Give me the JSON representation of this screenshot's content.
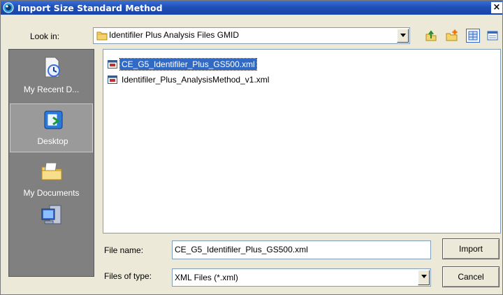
{
  "window": {
    "title": "Import Size Standard Method",
    "close_glyph": "×"
  },
  "look_in": {
    "label": "Look in:",
    "value": "Identifiler Plus Analysis Files GMID"
  },
  "toolbar": {
    "icons": [
      "up-folder-icon",
      "new-folder-icon",
      "list-view-icon",
      "details-view-icon"
    ]
  },
  "places": [
    {
      "label": "My Recent D...",
      "icon": "recent-documents-icon"
    },
    {
      "label": "Desktop",
      "icon": "desktop-icon"
    },
    {
      "label": "My Documents",
      "icon": "my-documents-icon"
    },
    {
      "label": "",
      "icon": "my-computer-icon"
    }
  ],
  "files": [
    {
      "name": "CE_G5_Identifiler_Plus_GS500.xml",
      "selected": true
    },
    {
      "name": "Identifiler_Plus_AnalysisMethod_v1.xml",
      "selected": false
    }
  ],
  "file_name": {
    "label": "File name:",
    "value": "CE_G5_Identifiler_Plus_GS500.xml"
  },
  "file_type": {
    "label": "Files of type:",
    "value": "XML Files (*.xml)"
  },
  "buttons": {
    "import": "Import",
    "cancel": "Cancel"
  },
  "colors": {
    "titlebar": "#1f4fb8",
    "selection": "#316ac5",
    "places_bg": "#808080",
    "dialog_bg": "#ece9d8"
  }
}
